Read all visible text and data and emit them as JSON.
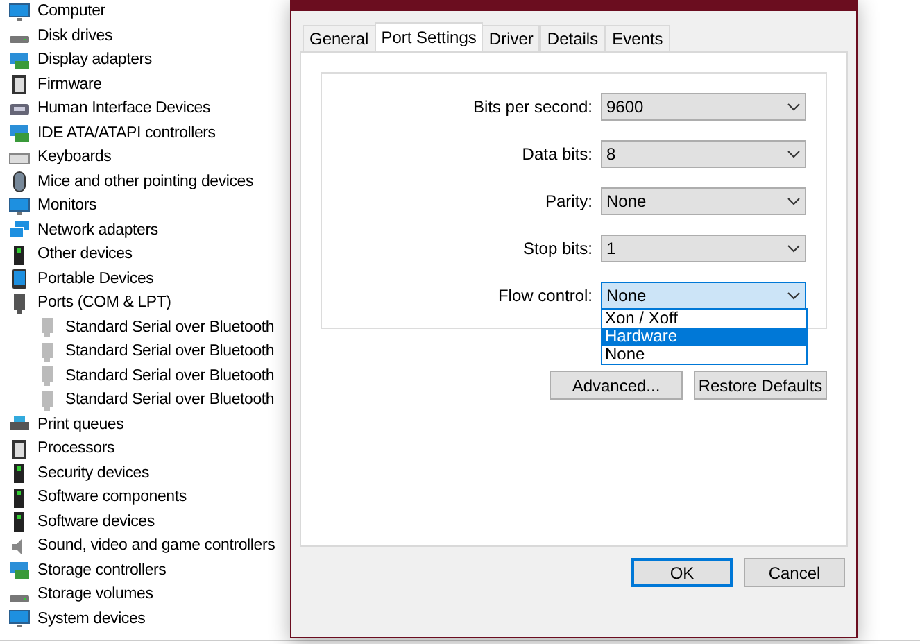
{
  "device_tree": [
    {
      "label": "Computer"
    },
    {
      "label": "Disk drives"
    },
    {
      "label": "Display adapters"
    },
    {
      "label": "Firmware"
    },
    {
      "label": "Human Interface Devices"
    },
    {
      "label": "IDE ATA/ATAPI controllers"
    },
    {
      "label": "Keyboards"
    },
    {
      "label": "Mice and other pointing devices"
    },
    {
      "label": "Monitors"
    },
    {
      "label": "Network adapters"
    },
    {
      "label": "Other devices"
    },
    {
      "label": "Portable Devices"
    },
    {
      "label": "Ports (COM & LPT)",
      "children": [
        {
          "label": "Standard Serial over Bluetooth"
        },
        {
          "label": "Standard Serial over Bluetooth"
        },
        {
          "label": "Standard Serial over Bluetooth"
        },
        {
          "label": "Standard Serial over Bluetooth"
        }
      ]
    },
    {
      "label": "Print queues"
    },
    {
      "label": "Processors"
    },
    {
      "label": "Security devices"
    },
    {
      "label": "Software components"
    },
    {
      "label": "Software devices"
    },
    {
      "label": "Sound, video and game controllers"
    },
    {
      "label": "Storage controllers"
    },
    {
      "label": "Storage volumes"
    },
    {
      "label": "System devices"
    }
  ],
  "dialog": {
    "tabs": [
      {
        "label": "General",
        "selected": false
      },
      {
        "label": "Port Settings",
        "selected": true
      },
      {
        "label": "Driver",
        "selected": false
      },
      {
        "label": "Details",
        "selected": false
      },
      {
        "label": "Events",
        "selected": false
      }
    ],
    "settings": [
      {
        "label": "Bits per second:",
        "value": "9600",
        "focused": false
      },
      {
        "label": "Data bits:",
        "value": "8",
        "focused": false
      },
      {
        "label": "Parity:",
        "value": "None",
        "focused": false
      },
      {
        "label": "Stop bits:",
        "value": "1",
        "focused": false
      },
      {
        "label": "Flow control:",
        "value": "None",
        "focused": true
      }
    ],
    "dropdown_options": [
      {
        "label": "Xon / Xoff",
        "selected": false
      },
      {
        "label": "Hardware",
        "selected": true
      },
      {
        "label": "None",
        "selected": false
      }
    ],
    "panel_buttons": [
      {
        "label": "Advanced...",
        "default": false
      },
      {
        "label": "Restore Defaults",
        "default": false
      }
    ],
    "buttons": [
      {
        "label": "OK",
        "default": true
      },
      {
        "label": "Cancel",
        "default": false
      }
    ]
  }
}
